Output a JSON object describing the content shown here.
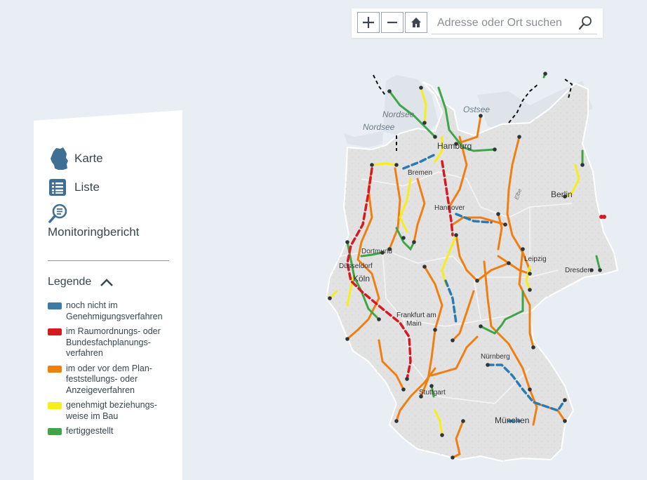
{
  "toolbar": {
    "zoom_in_icon": "plus-icon",
    "zoom_out_icon": "minus-icon",
    "home_icon": "home-icon",
    "search_placeholder": "Adresse oder Ort suchen",
    "search_icon": "search-icon"
  },
  "nav": {
    "map": {
      "label": "Karte",
      "icon": "germany-map-icon"
    },
    "list": {
      "label": "Liste",
      "icon": "list-icon"
    },
    "report": {
      "label": "Monitoringbericht",
      "icon": "report-search-icon"
    }
  },
  "legend": {
    "title": "Legende",
    "toggle_icon": "chevron-up-icon",
    "items": [
      {
        "label": "noch nicht im\nGenehmigungsverfahren",
        "color": "#3f7aa6"
      },
      {
        "label": "im Raumordnungs- oder\nBundesfachplanungs-\nverfahren",
        "color": "#d71920"
      },
      {
        "label": "im oder vor dem Plan-\nfeststellungs- oder\nAnzeigeverfahren",
        "color": "#f07f12"
      },
      {
        "label": "genehmigt beziehungs-\nweise im Bau",
        "color": "#f7ee18"
      },
      {
        "label": "fertiggestellt",
        "color": "#3fa648"
      }
    ]
  },
  "map": {
    "seas": [
      "Nordsee",
      "Nordsee",
      "Ostsee"
    ],
    "cities": [
      "Hamburg",
      "Bremen",
      "Hannover",
      "Berlin",
      "Dortmund",
      "Düsseldorf",
      "Köln",
      "Leipzig",
      "Dresden",
      "Frankfurt am",
      "Main",
      "Nürnberg",
      "Stuttgart",
      "München"
    ],
    "rivers": [
      "Elbe"
    ]
  }
}
